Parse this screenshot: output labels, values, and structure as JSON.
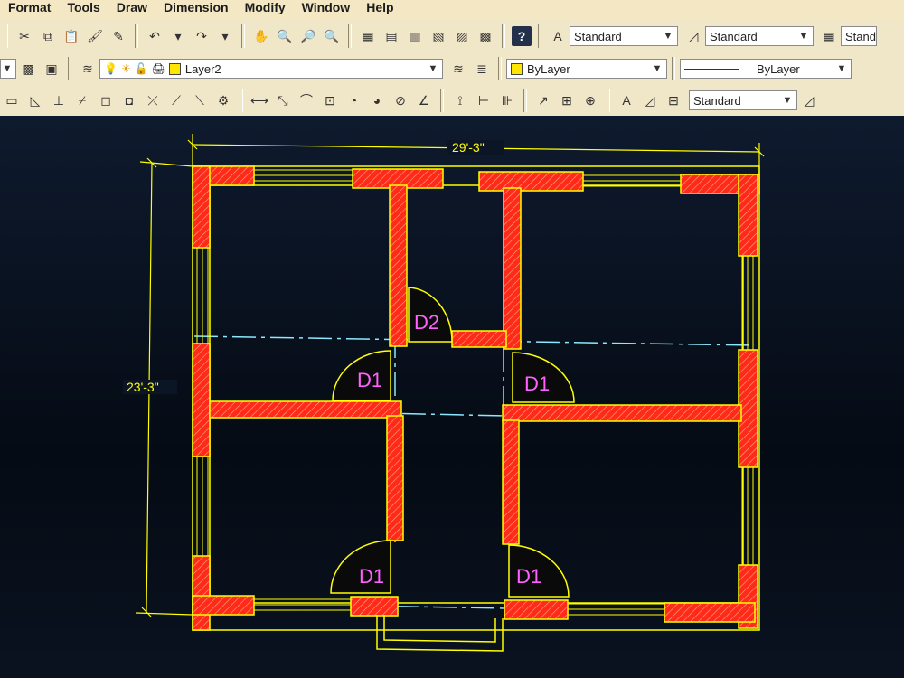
{
  "menus": [
    "Format",
    "Tools",
    "Draw",
    "Dimension",
    "Modify",
    "Window",
    "Help"
  ],
  "toolbar": {
    "text_style": "Standard",
    "dim_style": "Standard",
    "table_style": "Stand",
    "layer": "Layer2",
    "color": "ByLayer",
    "linetype": "ByLayer",
    "dimension_style_2": "Standard"
  },
  "drawing": {
    "dim_width": "29'-3\"",
    "dim_height": "23'-3\"",
    "doors": [
      "D1",
      "D1",
      "D1",
      "D1",
      "D2"
    ]
  },
  "colors": {
    "wall_outline": "#ffff00",
    "wall_hatch": "#ff2a1a",
    "text": "#ffffff",
    "door_label": "#ff60ff",
    "center_line": "#8de8ff",
    "dimension": "#ffff00"
  }
}
